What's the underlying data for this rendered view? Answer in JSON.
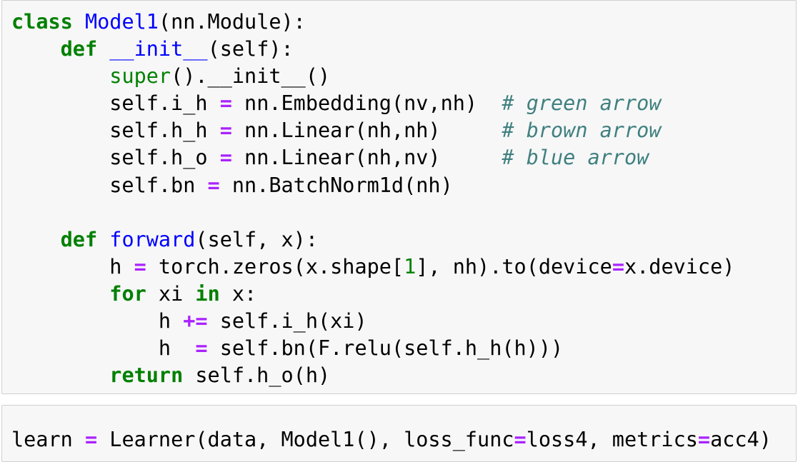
{
  "cells": [
    {
      "lines": [
        [
          {
            "t": "class",
            "c": "kw"
          },
          {
            "t": " "
          },
          {
            "t": "Model1",
            "c": "fn"
          },
          {
            "t": "(nn.Module):"
          }
        ],
        [
          {
            "t": "    "
          },
          {
            "t": "def",
            "c": "kw"
          },
          {
            "t": " "
          },
          {
            "t": "__init__",
            "c": "fn"
          },
          {
            "t": "(self):"
          }
        ],
        [
          {
            "t": "        "
          },
          {
            "t": "super",
            "c": "bi"
          },
          {
            "t": "().__init__()"
          }
        ],
        [
          {
            "t": "        self.i_h "
          },
          {
            "t": "=",
            "c": "op"
          },
          {
            "t": " nn.Embedding(nv,nh)  "
          },
          {
            "t": "# green arrow",
            "c": "cm"
          }
        ],
        [
          {
            "t": "        self.h_h "
          },
          {
            "t": "=",
            "c": "op"
          },
          {
            "t": " nn.Linear(nh,nh)     "
          },
          {
            "t": "# brown arrow",
            "c": "cm"
          }
        ],
        [
          {
            "t": "        self.h_o "
          },
          {
            "t": "=",
            "c": "op"
          },
          {
            "t": " nn.Linear(nh,nv)     "
          },
          {
            "t": "# blue arrow",
            "c": "cm"
          }
        ],
        [
          {
            "t": "        self.bn "
          },
          {
            "t": "=",
            "c": "op"
          },
          {
            "t": " nn.BatchNorm1d(nh)"
          }
        ],
        [
          {
            "t": ""
          }
        ],
        [
          {
            "t": "    "
          },
          {
            "t": "def",
            "c": "kw"
          },
          {
            "t": " "
          },
          {
            "t": "forward",
            "c": "fn"
          },
          {
            "t": "(self, x):"
          }
        ],
        [
          {
            "t": "        h "
          },
          {
            "t": "=",
            "c": "op"
          },
          {
            "t": " torch.zeros(x.shape["
          },
          {
            "t": "1",
            "c": "nm"
          },
          {
            "t": "], nh).to(device"
          },
          {
            "t": "=",
            "c": "op"
          },
          {
            "t": "x.device)"
          }
        ],
        [
          {
            "t": "        "
          },
          {
            "t": "for",
            "c": "kw"
          },
          {
            "t": " xi "
          },
          {
            "t": "in",
            "c": "kw"
          },
          {
            "t": " x:"
          }
        ],
        [
          {
            "t": "            h "
          },
          {
            "t": "+=",
            "c": "op"
          },
          {
            "t": " self.i_h(xi)"
          }
        ],
        [
          {
            "t": "            h  "
          },
          {
            "t": "=",
            "c": "op"
          },
          {
            "t": " self.bn(F.relu(self.h_h(h)))"
          }
        ],
        [
          {
            "t": "        "
          },
          {
            "t": "return",
            "c": "kw"
          },
          {
            "t": " self.h_o(h)"
          }
        ]
      ]
    },
    {
      "lines": [
        [
          {
            "t": "learn "
          },
          {
            "t": "=",
            "c": "op"
          },
          {
            "t": " Learner(data, Model1(), loss_func"
          },
          {
            "t": "=",
            "c": "op"
          },
          {
            "t": "loss4, metrics"
          },
          {
            "t": "=",
            "c": "op"
          },
          {
            "t": "acc4)"
          }
        ]
      ]
    }
  ]
}
